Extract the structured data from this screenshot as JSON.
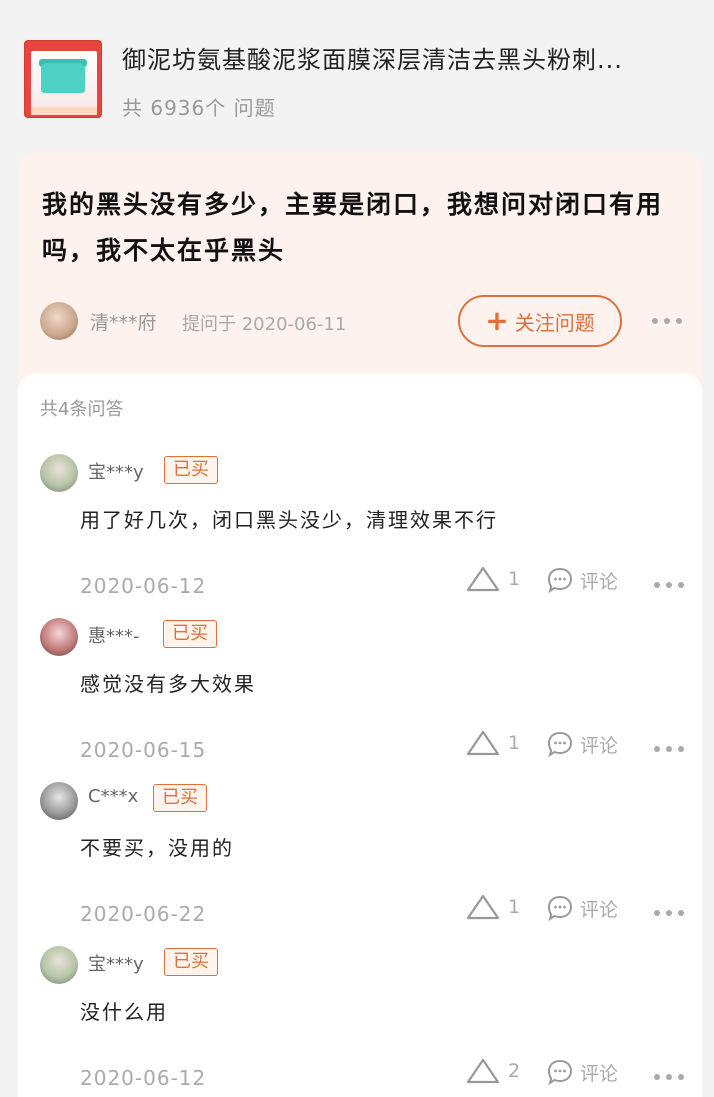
{
  "product": {
    "title": "御泥坊氨基酸泥浆面膜深层清洁去黑头粉刺...",
    "count_text": "共 6936个 问题"
  },
  "question": {
    "text": "我的黑头没有多少，主要是闭口，我想问对闭口有用吗，我不太在乎黑头",
    "asker": "清***府",
    "meta": "提问于 2020-06-11",
    "follow_label": "关注问题"
  },
  "answers_header": "共4条问答",
  "bought_label": "已买",
  "comment_label": "评论",
  "answers": [
    {
      "name": "宝***y",
      "bought": true,
      "text": "用了好几次，闭口黑头没少，清理效果不行",
      "date": "2020-06-12",
      "likes": "1"
    },
    {
      "name": "惠***-",
      "bought": true,
      "text": "感觉没有多大效果",
      "date": "2020-06-15",
      "likes": "1"
    },
    {
      "name": "C***x",
      "bought": true,
      "text": "不要买，没用的",
      "date": "2020-06-22",
      "likes": "1"
    },
    {
      "name": "宝***y",
      "bought": true,
      "text": "没什么用",
      "date": "2020-06-12",
      "likes": "2"
    }
  ],
  "colors": {
    "accent": "#e0703a",
    "card_bg": "#fdf2ee",
    "page_bg": "#f3f3f3"
  },
  "icons": [
    "plus-icon",
    "more-icon",
    "like-triangle-icon",
    "comment-bubble-icon"
  ]
}
